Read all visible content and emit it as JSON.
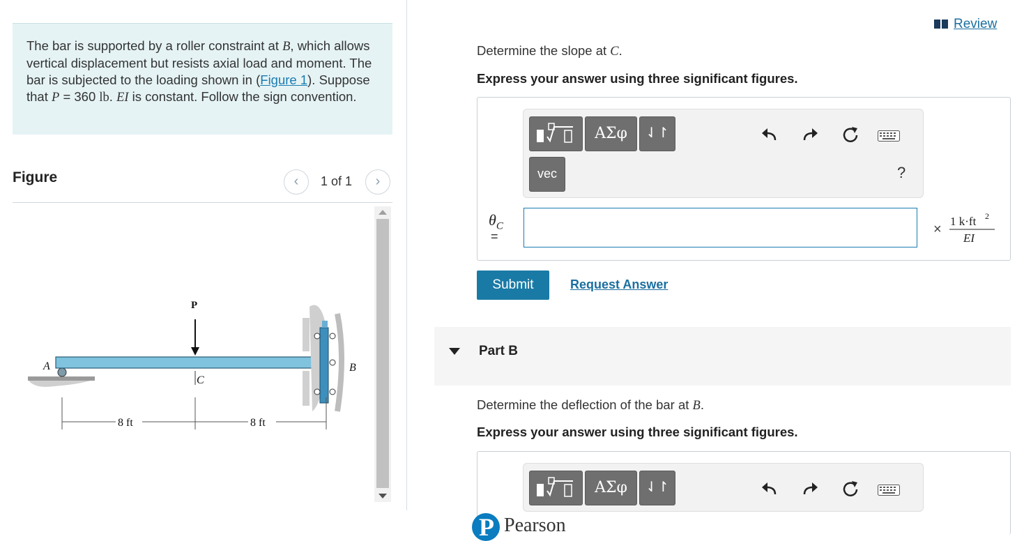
{
  "problem": {
    "text_1": "The bar is supported by a roller constraint at ",
    "var_B": "B",
    "text_2": ", which allows vertical displacement but resists axial load and moment. The bar is subjected to the loading shown in (",
    "figure_link": "Figure 1",
    "text_3": "). Suppose that ",
    "var_P": "P",
    "text_4": " = 360 ",
    "unit_lb": "lb",
    "text_5": ". ",
    "var_EI": "EI",
    "text_6": " is constant. Follow the sign convention."
  },
  "figure": {
    "heading": "Figure",
    "pager": "1 of 1",
    "labels": {
      "load": "P",
      "point_a": "A",
      "point_b": "B",
      "point_c": "C",
      "dim_1": "8 ft",
      "dim_2": "8 ft"
    }
  },
  "review_link": "Review",
  "part_a": {
    "question_1": "Determine the slope at ",
    "question_var": "C",
    "question_2": ".",
    "instruction": "Express your answer using three significant figures.",
    "vec_label": "vec",
    "greek_label": "ΑΣφ",
    "help_label": "?",
    "theta_symbol": "θ",
    "theta_sub": "C",
    "equals": "=",
    "input_value": "",
    "units": {
      "times": "×",
      "numerator": "1 k·ft",
      "exponent": "2",
      "denominator": "EI"
    },
    "submit_label": "Submit",
    "request_answer_label": "Request Answer"
  },
  "part_b": {
    "title": "Part B",
    "question_1": "Determine the deflection of the bar at ",
    "question_var": "B",
    "question_2": ".",
    "instruction": "Express your answer using three significant figures.",
    "greek_label": "ΑΣφ"
  },
  "footer": {
    "brand": "Pearson",
    "logo_letter": "P"
  },
  "colors": {
    "accent": "#1a7aa6",
    "problem_bg": "#e5f3f5",
    "toolbar_button": "#6f6f6f",
    "bar_fill": "#7fc3de"
  },
  "icons": [
    "templates-icon",
    "undo-icon",
    "redo-icon",
    "reset-icon",
    "keyboard-icon",
    "book-icon",
    "chevron-left-icon",
    "chevron-right-icon"
  ]
}
